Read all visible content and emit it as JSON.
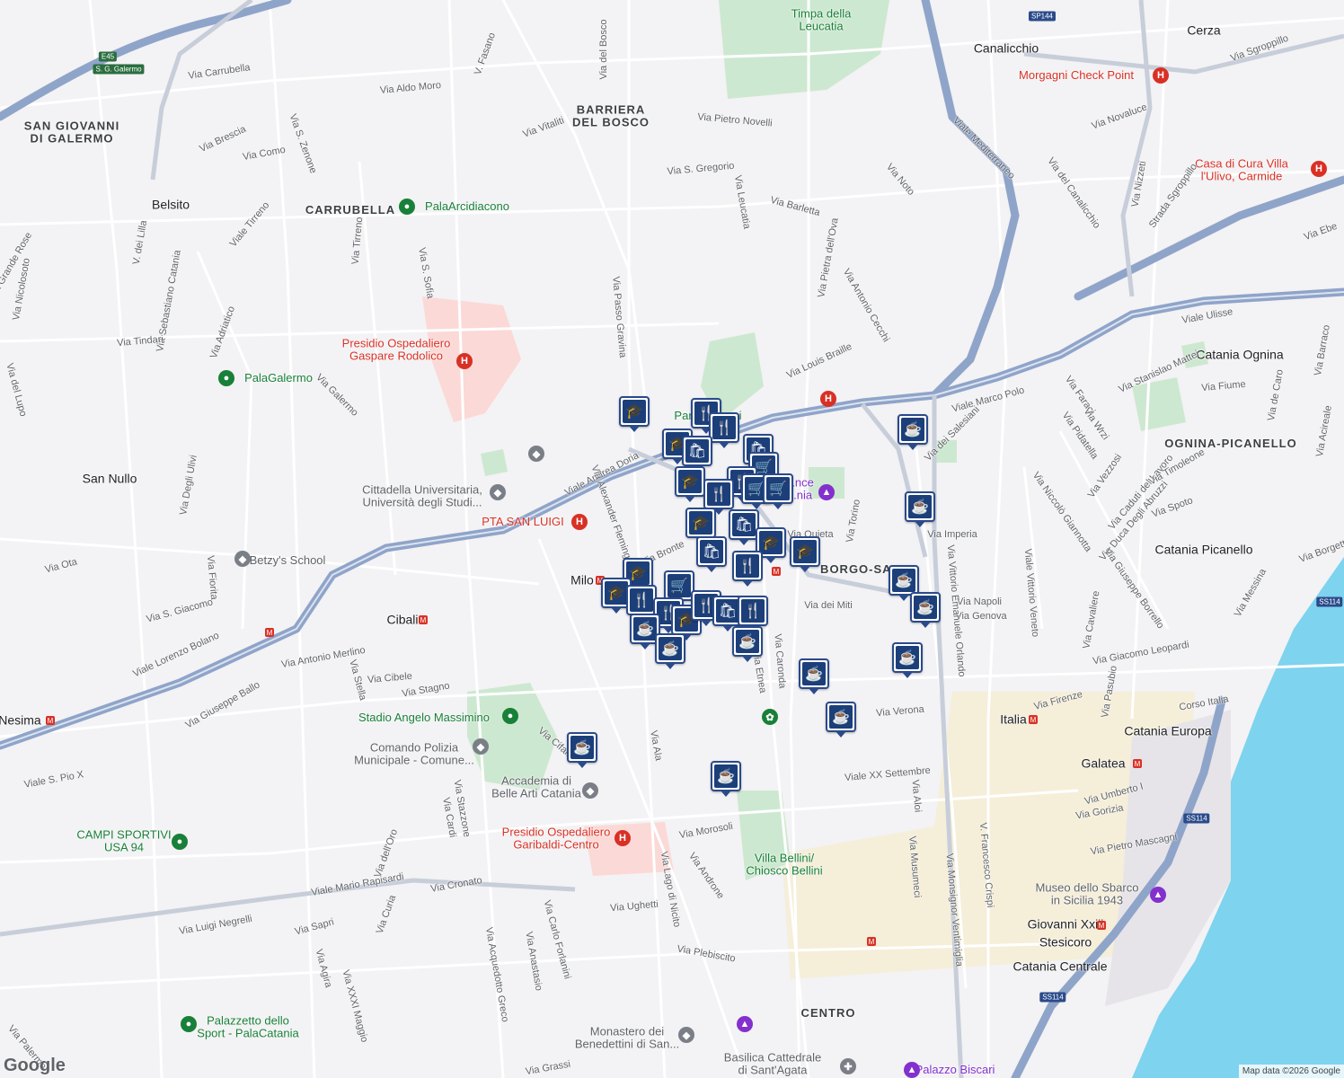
{
  "map": {
    "colors": {
      "land": "#f3f2f4",
      "road": "#ffffff",
      "road_outline": "#d8d8dc",
      "highway": "#8fa4c9",
      "green": "#cde8d0",
      "water": "#7ed3ee",
      "hospital": "#fbd9d6",
      "beige": "#f5ecd0"
    },
    "attribution": "Map data ©2026 Google",
    "logo": "Google",
    "shields": [
      {
        "text": "E45"
      },
      {
        "text": "S. G. Galermo"
      },
      {
        "text": "SP144"
      },
      {
        "text": "SS114"
      },
      {
        "text": "SS114"
      },
      {
        "text": "SS114"
      }
    ],
    "areas": [
      "SAN GIOVANNI\nDI GALERMO",
      "BARRIERA\nDEL BOSCO",
      "CARRUBELLA",
      "OGNINA-PICANELLO",
      "BORGO-SAN",
      "CENTRO"
    ],
    "places": [
      "Belsito",
      "San Nullo",
      "Canalicchio",
      "Cerza",
      "Cibali",
      "Milo",
      "Nesima",
      "Italia",
      "Galatea",
      "Stesicoro",
      "Giovanni Xxiii",
      "Catania Centrale",
      "Catania Europa",
      "Catania Picanello",
      "Catania Ognina"
    ],
    "pois": {
      "green": [
        "Timpa della\nLeucatia",
        "PalaArcidiacono",
        "PalaGalermo",
        "Stadio Angelo Massimino",
        "CAMPI SPORTIVI\nUSA 94",
        "Palazzetto dello\nSport - PalaCatania",
        "Villa Bellini/\nChiosco Bellini",
        "Parco Gioeni"
      ],
      "red": [
        "Morgagni Check Point",
        "Casa di Cura Villa\nl'Ulivo, Carmide",
        "Presidio Ospedaliero\nGaspare Rodolico",
        "PTA SAN LUIGI",
        "Presidio Ospedaliero\nGaribaldi-Centro"
      ],
      "gray": [
        "Cittadella Universitaria,\nUniversità degli Studi...",
        "Betzy's School",
        "Comando Polizia\nMunicipale - Comune...",
        "Accademia di\nBelle Arti Catania",
        "Monastero dei\nBenedettini di San...",
        "Basilica Cattedrale\ndi Sant'Agata",
        "Museo dello Sbarco\nin Sicilia 1943"
      ],
      "purple": [
        "Palazzo Biscari",
        "...nce\n...nia"
      ]
    },
    "streets": [
      "Via Carrubella",
      "Via Aldo Moro",
      "Via Brescia",
      "Via Como",
      "Via S. Zenone",
      "V. Fasano",
      "Via Vitaliti",
      "Via del Bosco",
      "Via Pietro Novelli",
      "Via S. Gregorio",
      "Via Leucatia",
      "Via Barletta",
      "Via Pietra dell'Ova",
      "Via Antonio Cecchi",
      "Via Louis Braille",
      "Via Noto",
      "Viale Mediterraneo",
      "Via del Canalicchio",
      "Via Novaluce",
      "Via Sgroppillo",
      "Via Nizzeti",
      "Strada Sgroppillo",
      "Via Ebe",
      "Viale Ulisse",
      "Viale Marco Polo",
      "Via dei Salesiani",
      "Via Stanislao Mattei",
      "Via Fiume",
      "Via Faraci",
      "Via Wrzi",
      "Via Pidatella",
      "Via Vezzosi",
      "Via Caduti del Lavoro",
      "Via Timoleone",
      "Via Spoto",
      "Via Duca Degli Abruzzi",
      "Via Niccolò Giannotta",
      "Via Giuseppe Borrello",
      "Via Messina",
      "Via Cavaliere",
      "Viale Vittorio Veneto",
      "Via Napoli",
      "Via Genova",
      "Via Giacomo Leopardi",
      "Via Pasubio",
      "Corso Italia",
      "Via Firenze",
      "Via Verona",
      "Viale XX Settembre",
      "Via Aloi",
      "Via Umberto I",
      "Via Gorizia",
      "Via Pietro Mascagni",
      "Via Musumeci",
      "V. Francesco Crispi",
      "Via Monsignor Ventimiglia",
      "Via Vittorio Emanuele Orlando",
      "Via Imperia",
      "Via Torino",
      "Via dei Miti",
      "Via Caronda",
      "Via Etnea",
      "Via Bronte",
      "Viale Andrea Doria",
      "Via Alexander Fleming",
      "Via Passo Gravina",
      "Viale Tirreno",
      "Via Tirreno",
      "Via S. Sofia",
      "V. dei Lilla",
      "Via Sebastiano Catania",
      "Via Adriatico",
      "Via Tindari",
      "Via Galermo",
      "Via Nicolosoto",
      "Via del Lupo",
      "Via Degli Ulivi",
      "Via Ota",
      "Via Fiorita",
      "Via S. Giacomo",
      "Viale Lorenzo Bolano",
      "Via Antonio Merlino",
      "Via Stella",
      "Via Cibele",
      "Via Stagno",
      "Via Giuseppe Ballo",
      "Viale S. Pio X",
      "Via Cifali",
      "Via Ala",
      "Via Stazzone",
      "Via Cardi",
      "Via dell'Oro",
      "Via Cronato",
      "Viale Mario Rapisardi",
      "Via Luigi Negrelli",
      "Via Sapri",
      "Via Curia",
      "Via Agira",
      "Via XXXI Maggio",
      "Via Carlo Forlanini",
      "Via Anastasio",
      "Via Acquedotto Greco",
      "Via Ughetti",
      "Via Lago di Nicito",
      "Via Androne",
      "Via Morosoli",
      "Via Plebiscito",
      "Via Grassi",
      "Via Palermo",
      "Via Barraco",
      "Via Acireale",
      "Via de Caro",
      "Via Borgetto",
      "Via Quieta",
      "Via Grande Rose"
    ],
    "markers": [
      {
        "icon": "school"
      },
      {
        "icon": "restaurant"
      },
      {
        "icon": "restaurant"
      },
      {
        "icon": "school"
      },
      {
        "icon": "shopping"
      },
      {
        "icon": "shopping"
      },
      {
        "icon": "grocery"
      },
      {
        "icon": "school"
      },
      {
        "icon": "restaurant"
      },
      {
        "icon": "restaurant"
      },
      {
        "icon": "grocery"
      },
      {
        "icon": "grocery"
      },
      {
        "icon": "school"
      },
      {
        "icon": "shopping"
      },
      {
        "icon": "school"
      },
      {
        "icon": "school"
      },
      {
        "icon": "shopping"
      },
      {
        "icon": "restaurant"
      },
      {
        "icon": "school"
      },
      {
        "icon": "school"
      },
      {
        "icon": "restaurant"
      },
      {
        "icon": "grocery"
      },
      {
        "icon": "restaurant"
      },
      {
        "icon": "school"
      },
      {
        "icon": "restaurant"
      },
      {
        "icon": "shopping"
      },
      {
        "icon": "restaurant"
      },
      {
        "icon": "cafe"
      },
      {
        "icon": "cafe"
      },
      {
        "icon": "cafe"
      },
      {
        "icon": "cafe"
      },
      {
        "icon": "cafe"
      },
      {
        "icon": "cafe"
      },
      {
        "icon": "cafe"
      },
      {
        "icon": "cafe"
      },
      {
        "icon": "cafe"
      },
      {
        "icon": "cafe"
      },
      {
        "icon": "cafe"
      },
      {
        "icon": "cafe"
      }
    ]
  }
}
